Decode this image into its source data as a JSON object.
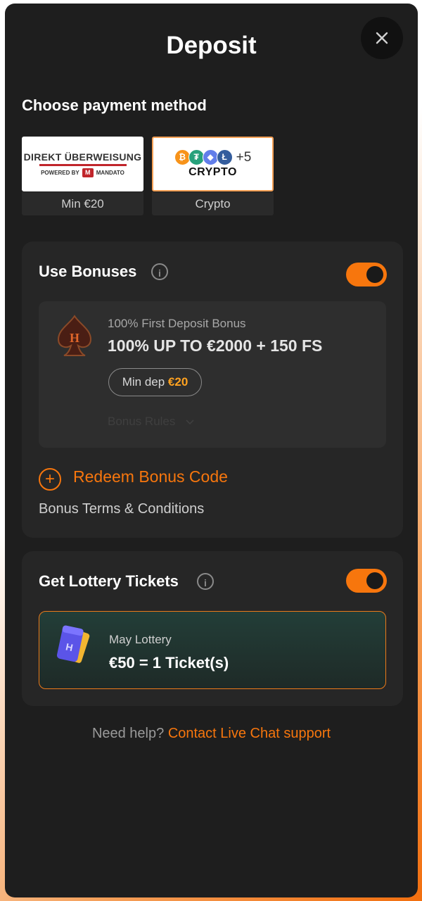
{
  "header": {
    "title": "Deposit",
    "close_icon": "close-icon"
  },
  "payment": {
    "title": "Choose payment method",
    "methods": [
      {
        "logo_line1": "DIREKT ÜBERWEISUNG",
        "logo_line2": "POWERED BY",
        "logo_brand": "MANDATO",
        "caption": "Min €20",
        "selected": false
      },
      {
        "logo_extra": "+5",
        "logo_label": "CRYPTO",
        "caption": "Crypto",
        "selected": true
      }
    ]
  },
  "bonuses": {
    "title": "Use Bonuses",
    "info_icon": "info-icon",
    "toggle_on": true,
    "card": {
      "subtitle": "100% First Deposit Bonus",
      "headline": "100% UP TO €2000 + 150 FS",
      "min_label": "Min dep",
      "min_value": "€20",
      "rules_label": "Bonus Rules"
    },
    "redeem_label": "Redeem Bonus Code",
    "terms_label": "Bonus Terms & Conditions"
  },
  "lottery": {
    "title": "Get Lottery Tickets",
    "info_icon": "info-icon",
    "toggle_on": true,
    "card": {
      "subtitle": "May Lottery",
      "headline": "€50 = 1 Ticket(s)"
    }
  },
  "help": {
    "prefix": "Need help?",
    "link": "Contact Live Chat support"
  },
  "colors": {
    "accent": "#f7760d",
    "background": "#1e1e1e",
    "section": "#262626",
    "highlight": "#ffa220"
  }
}
